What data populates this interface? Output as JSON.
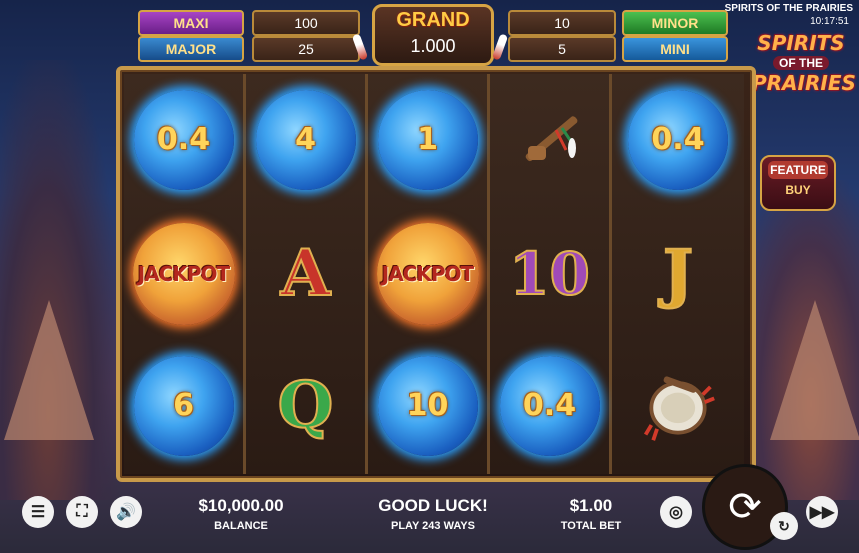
{
  "game": {
    "title": "SPIRITS OF THE PRAIRIES",
    "clock": "10:17:51"
  },
  "logo": {
    "line1": "SPIRITS",
    "line2": "OF THE",
    "line3": "PRAIRIES"
  },
  "feature_buy": {
    "line1": "FEATURE",
    "line2": "BUY"
  },
  "jackpots": {
    "maxi": {
      "label": "MAXI",
      "value": "100"
    },
    "major": {
      "label": "MAJOR",
      "value": "25"
    },
    "grand": {
      "label": "GRAND",
      "value": "1.000"
    },
    "minor": {
      "label": "MINOR",
      "value": "10"
    },
    "mini": {
      "label": "MINI",
      "value": "5"
    }
  },
  "reels": [
    [
      {
        "type": "moon",
        "text": "0.4"
      },
      {
        "type": "jackpot",
        "text": "JACKPOT"
      },
      {
        "type": "moon",
        "text": "6"
      }
    ],
    [
      {
        "type": "moon",
        "text": "4"
      },
      {
        "type": "letter",
        "text": "A"
      },
      {
        "type": "letter",
        "text": "Q"
      }
    ],
    [
      {
        "type": "moon",
        "text": "1"
      },
      {
        "type": "jackpot",
        "text": "JACKPOT"
      },
      {
        "type": "moon",
        "text": "10"
      }
    ],
    [
      {
        "type": "pipe-icon",
        "text": ""
      },
      {
        "type": "letter",
        "text": "10"
      },
      {
        "type": "moon",
        "text": "0.4"
      }
    ],
    [
      {
        "type": "moon",
        "text": "0.4"
      },
      {
        "type": "letter",
        "text": "J"
      },
      {
        "type": "drum-icon",
        "text": ""
      }
    ]
  ],
  "bottom": {
    "balance_value": "$10,000.00",
    "balance_label": "BALANCE",
    "message": "GOOD LUCK!",
    "ways": "PLAY 243 WAYS",
    "bet_value": "$1.00",
    "bet_label": "TOTAL BET"
  },
  "colors": {
    "maxi": "#8a2fa8",
    "major": "#1f6fb0",
    "minor": "#2f9a36",
    "mini": "#1f74b8",
    "frame": "#c89a4a"
  }
}
